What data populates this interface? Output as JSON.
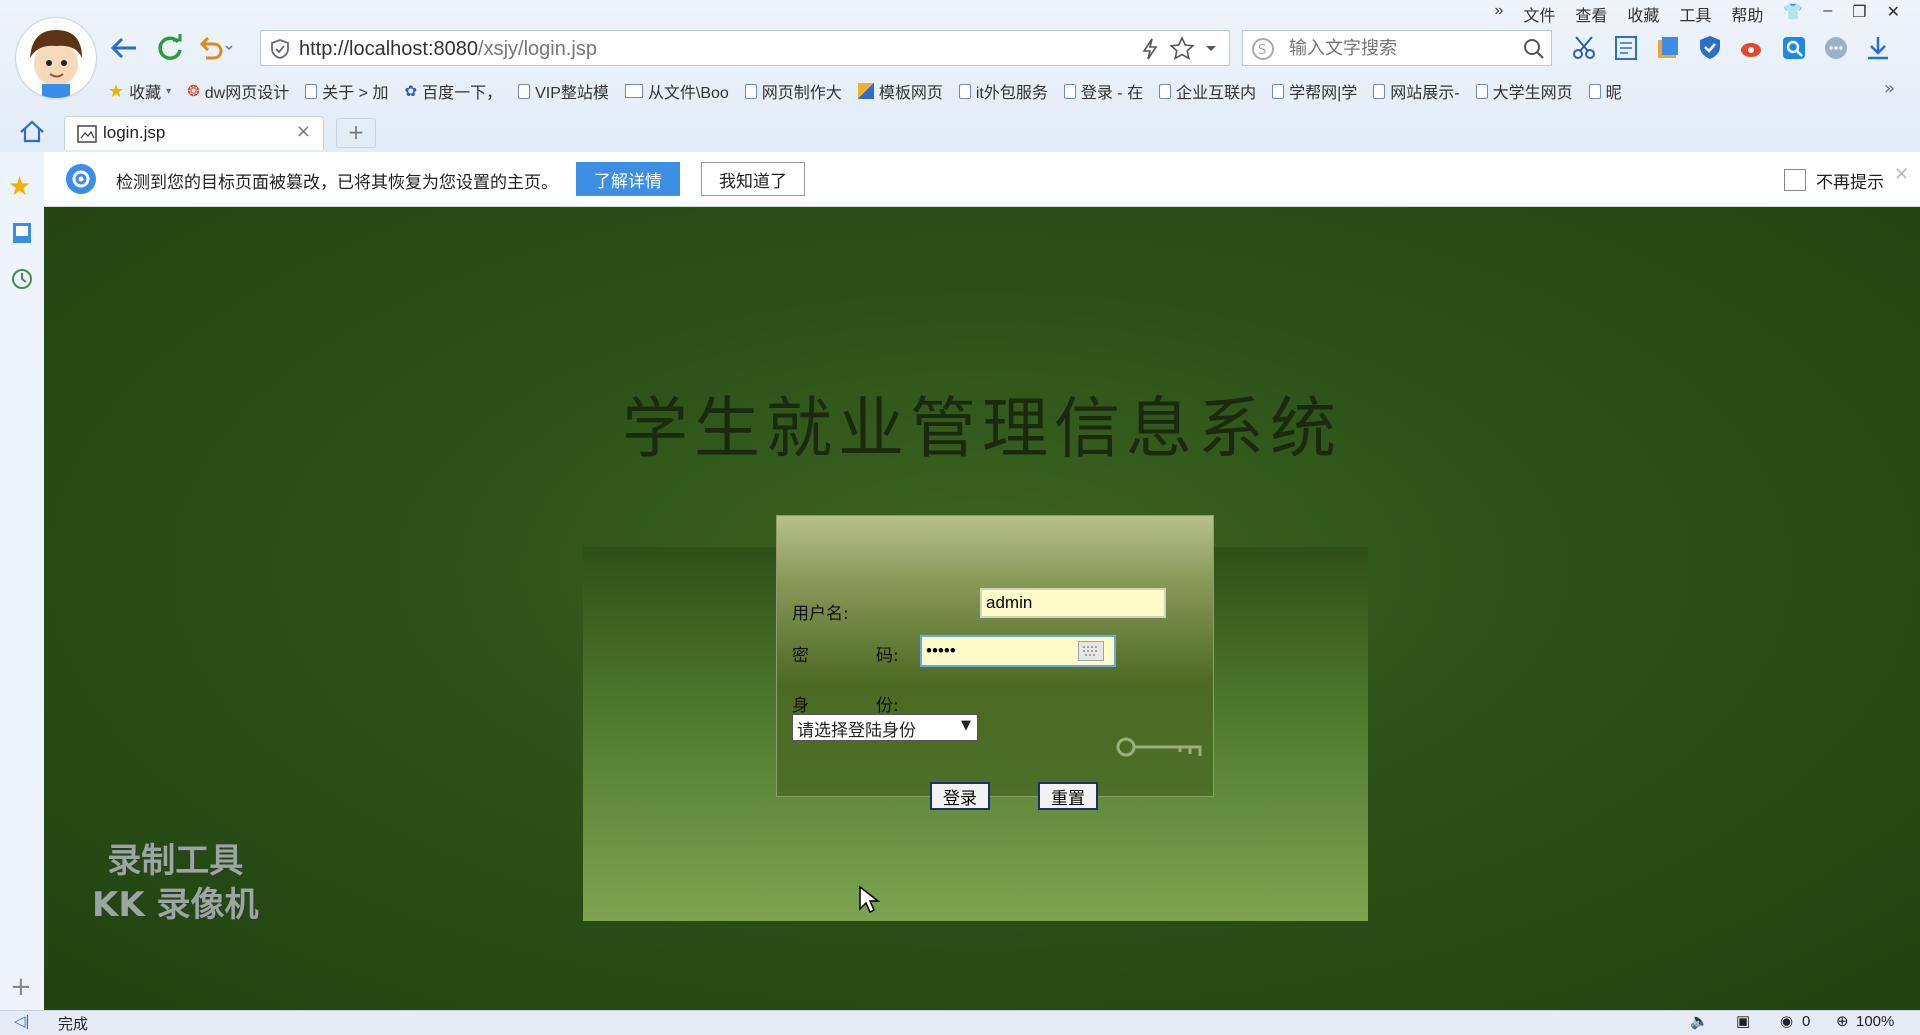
{
  "browser": {
    "menu": [
      "文件",
      "查看",
      "收藏",
      "工具",
      "帮助"
    ],
    "address": {
      "host": "http://localhost:8080",
      "path": "/xsjy/login.jsp"
    },
    "search": {
      "placeholder": "输入文字搜索"
    },
    "bookmarks": [
      "收藏",
      "dw网页设计",
      "关于 > 加",
      "百度一下，",
      "VIP整站模",
      "从文件\\Boo",
      "网页制作大",
      "模板网页",
      "it外包服务",
      "登录 - 在",
      "企业互联内",
      "学帮网|学",
      "网站展示-",
      "大学生网页",
      "昵"
    ],
    "tab": {
      "title": "login.jsp"
    },
    "infobar": {
      "message": "检测到您的目标页面被篡改，已将其恢复为您设置的主页。",
      "details_label": "了解详情",
      "gotit_label": "我知道了",
      "noremind_label": "不再提示"
    },
    "status": {
      "text": "完成",
      "count": "0",
      "zoom": "100%"
    }
  },
  "page": {
    "title": "学生就业管理信息系统",
    "form": {
      "username_label": "用户名:",
      "username_value": "admin",
      "password_label_a": "密",
      "password_label_b": "码:",
      "password_value": "•••••",
      "role_label_a": "身",
      "role_label_b": "份:",
      "role_selected": "请选择登陆身份",
      "login_label": "登录",
      "reset_label": "重置"
    },
    "watermark": {
      "line1": "录制工具",
      "line2": "KK 录像机"
    }
  }
}
